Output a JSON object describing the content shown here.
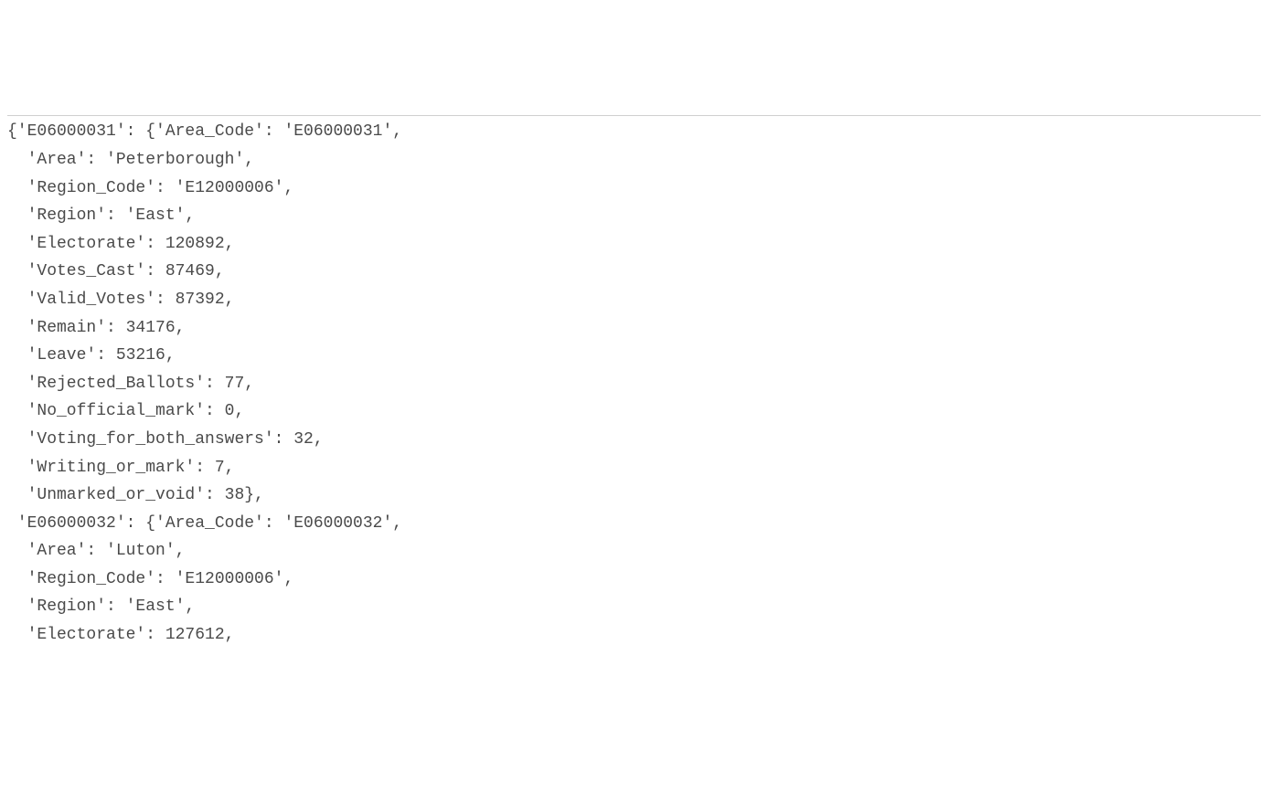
{
  "code_lines": [
    "{'E06000031': {'Area_Code': 'E06000031',",
    "  'Area': 'Peterborough',",
    "  'Region_Code': 'E12000006',",
    "  'Region': 'East',",
    "  'Electorate': 120892,",
    "  'Votes_Cast': 87469,",
    "  'Valid_Votes': 87392,",
    "  'Remain': 34176,",
    "  'Leave': 53216,",
    "  'Rejected_Ballots': 77,",
    "  'No_official_mark': 0,",
    "  'Voting_for_both_answers': 32,",
    "  'Writing_or_mark': 7,",
    "  'Unmarked_or_void': 38},",
    " 'E06000032': {'Area_Code': 'E06000032',",
    "  'Area': 'Luton',",
    "  'Region_Code': 'E12000006',",
    "  'Region': 'East',",
    "  'Electorate': 127612,"
  ]
}
